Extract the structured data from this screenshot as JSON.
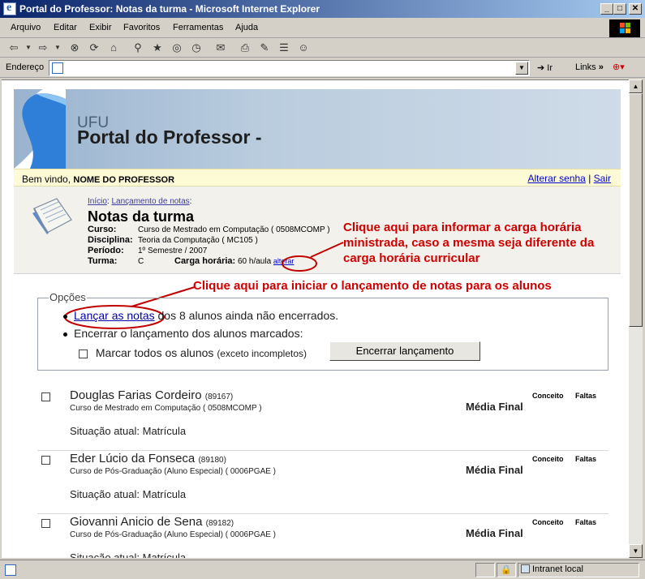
{
  "window": {
    "title": "Portal do Professor: Notas da turma - Microsoft Internet Explorer",
    "minimize": "_",
    "maximize": "□",
    "close": "✕"
  },
  "menu": [
    "Arquivo",
    "Editar",
    "Exibir",
    "Favoritos",
    "Ferramentas",
    "Ajuda"
  ],
  "toolbar": {
    "icons": [
      "back-icon",
      "forward-icon",
      "stop-icon",
      "refresh-icon",
      "home-icon",
      "search-icon",
      "favorites-icon",
      "media-icon",
      "history-icon",
      "mail-icon",
      "print-icon",
      "edit-icon",
      "discuss-icon",
      "messenger-icon"
    ]
  },
  "address": {
    "label": "Endereço",
    "value": "",
    "go_label": "Ir",
    "links_label": "Links"
  },
  "banner": {
    "org": "UFU",
    "title": "Portal do Professor -"
  },
  "welcome": {
    "text": "Bem vindo, ",
    "user": "NOME DO PROFESSOR",
    "change_password": "Alterar senha",
    "separator": "|",
    "logout": "Sair"
  },
  "breadcrumb": {
    "home": "Início",
    "sep": ":",
    "current": "Lançamento de notas",
    "trail": ":"
  },
  "page_title": "Notas da turma",
  "class_info": {
    "curso_label": "Curso:",
    "curso": "Curso de Mestrado em Computação ( 0508MCOMP )",
    "disciplina_label": "Disciplina:",
    "disciplina": "Teoria da Computação ( MC105 )",
    "periodo_label": "Período:",
    "periodo": "1º Semestre / 2007",
    "turma_label": "Turma:",
    "turma": "C",
    "carga_label": "Carga horária:",
    "carga": "60 h/aula",
    "alterar": "alterar"
  },
  "annotations": {
    "carga_note_1": "Clique aqui para informar a carga horária",
    "carga_note_2": "ministrada, caso a mesma seja diferente da",
    "carga_note_3": "carga horária curricular",
    "lancar_note": "Clique aqui para iniciar o lançamento de notas para os alunos"
  },
  "options": {
    "legend": "Opções",
    "lancar_link": "Lançar as notas",
    "lancar_rest": " dos 8 alunos ainda não encerrados.",
    "encerrar_text": "Encerrar o lançamento dos alunos marcados:",
    "marcar_label": "Marcar todos os alunos",
    "marcar_note": "(exceto incompletos)",
    "encerrar_button": "Encerrar lançamento"
  },
  "students": [
    {
      "name": "Douglas Farias Cordeiro",
      "id": "(89167)",
      "course": "Curso de Mestrado em Computação ( 0508MCOMP )",
      "situacao": "Situação atual: Matrícula",
      "media": "Média Final",
      "conceito": "Conceito",
      "faltas": "Faltas"
    },
    {
      "name": "Eder Lúcio da Fonseca",
      "id": "(89180)",
      "course": "Curso de Pós-Graduação (Aluno Especial) ( 0006PGAE )",
      "situacao": "Situação atual: Matrícula",
      "media": "Média Final",
      "conceito": "Conceito",
      "faltas": "Faltas"
    },
    {
      "name": "Giovanni Anicio de Sena",
      "id": "(89182)",
      "course": "Curso de Pós-Graduação (Aluno Especial) ( 0006PGAE )",
      "situacao": "Situação atual: Matrícula",
      "media": "Média Final",
      "conceito": "Conceito",
      "faltas": "Faltas"
    }
  ],
  "status": {
    "zone": "Intranet local"
  }
}
